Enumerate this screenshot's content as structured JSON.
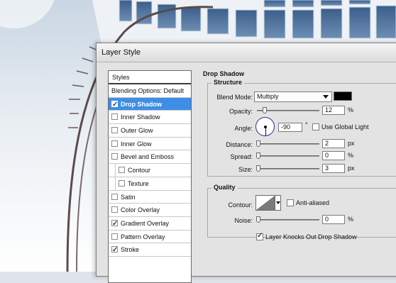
{
  "dialog": {
    "title": "Layer Style"
  },
  "styles_list": {
    "header": "Styles",
    "blending_options": "Blending Options: Default",
    "items": [
      {
        "label": "Drop Shadow",
        "checked": true,
        "selected": true,
        "indent": false
      },
      {
        "label": "Inner Shadow",
        "checked": false,
        "selected": false,
        "indent": false
      },
      {
        "label": "Outer Glow",
        "checked": false,
        "selected": false,
        "indent": false
      },
      {
        "label": "Inner Glow",
        "checked": false,
        "selected": false,
        "indent": false
      },
      {
        "label": "Bevel and Emboss",
        "checked": false,
        "selected": false,
        "indent": false
      },
      {
        "label": "Contour",
        "checked": false,
        "selected": false,
        "indent": true
      },
      {
        "label": "Texture",
        "checked": false,
        "selected": false,
        "indent": true
      },
      {
        "label": "Satin",
        "checked": false,
        "selected": false,
        "indent": false
      },
      {
        "label": "Color Overlay",
        "checked": false,
        "selected": false,
        "indent": false
      },
      {
        "label": "Gradient Overlay",
        "checked": true,
        "selected": false,
        "indent": false
      },
      {
        "label": "Pattern Overlay",
        "checked": false,
        "selected": false,
        "indent": false
      },
      {
        "label": "Stroke",
        "checked": true,
        "selected": false,
        "indent": false
      }
    ]
  },
  "drop_shadow": {
    "title": "Drop Shadow",
    "structure": {
      "title": "Structure",
      "blend_mode_label": "Blend Mode:",
      "blend_mode_value": "Multiply",
      "shadow_color": "#000000",
      "opacity_label": "Opacity:",
      "opacity_value": "12",
      "opacity_unit": "%",
      "angle_label": "Angle:",
      "angle_value": "-90",
      "angle_unit": "°",
      "use_global_light_label": "Use Global Light",
      "use_global_light_checked": false,
      "distance_label": "Distance:",
      "distance_value": "2",
      "distance_unit": "px",
      "spread_label": "Spread:",
      "spread_value": "0",
      "spread_unit": "%",
      "size_label": "Size:",
      "size_value": "3",
      "size_unit": "px"
    },
    "quality": {
      "title": "Quality",
      "contour_label": "Contour:",
      "anti_aliased_label": "Anti-aliased",
      "anti_aliased_checked": false,
      "noise_label": "Noise:",
      "noise_value": "0",
      "noise_unit": "%"
    },
    "layer_knocks_out_label": "Layer Knocks Out Drop Shadow",
    "layer_knocks_out_checked": true
  }
}
